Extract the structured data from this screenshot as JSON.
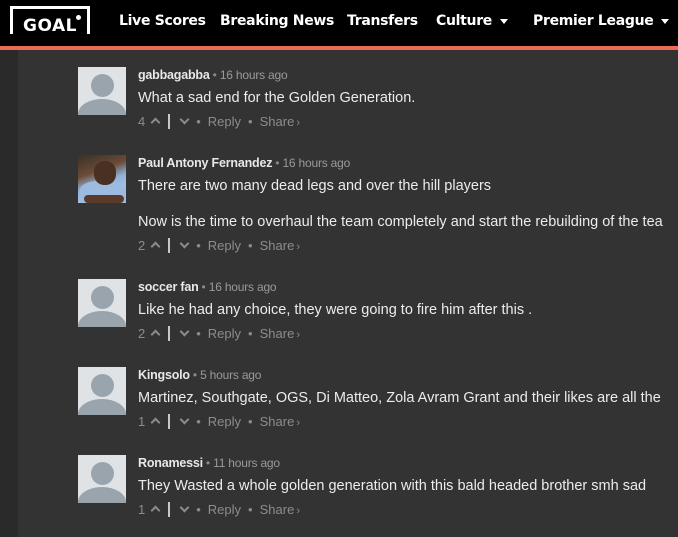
{
  "header": {
    "logo_text": "GOAL",
    "nav": [
      {
        "label": "Live Scores",
        "has_dropdown": false
      },
      {
        "label": "Breaking News",
        "has_dropdown": false
      },
      {
        "label": "Transfers",
        "has_dropdown": false
      },
      {
        "label": "Culture",
        "has_dropdown": true
      },
      {
        "label": "Premier League",
        "has_dropdown": true
      }
    ],
    "accent_color": "#ee6a56"
  },
  "comments": [
    {
      "author": "gabbagabba",
      "time": "16 hours ago",
      "paragraphs": [
        "What a sad end for the Golden Generation."
      ],
      "votes": "4",
      "reply_label": "Reply",
      "share_label": "Share",
      "avatar": "default-avatar"
    },
    {
      "author": "Paul Antony Fernandez",
      "time": "16 hours ago",
      "paragraphs": [
        "There are two many dead legs and over the hill players",
        "Now is the time to overhaul the team completely and start the rebuilding of the tea"
      ],
      "votes": "2",
      "reply_label": "Reply",
      "share_label": "Share",
      "avatar": "user-photo"
    },
    {
      "author": "soccer fan",
      "time": "16 hours ago",
      "paragraphs": [
        "Like he had any choice, they were going to fire him after this ."
      ],
      "votes": "2",
      "reply_label": "Reply",
      "share_label": "Share",
      "avatar": "default-avatar"
    },
    {
      "author": "Kingsolo",
      "time": "5 hours ago",
      "paragraphs": [
        "Martinez, Southgate, OGS, Di Matteo, Zola Avram Grant and their likes are all the"
      ],
      "votes": "1",
      "reply_label": "Reply",
      "share_label": "Share",
      "avatar": "default-avatar"
    },
    {
      "author": "Ronamessi",
      "time": "11 hours ago",
      "paragraphs": [
        "They Wasted a whole golden generation with this bald headed brother smh sad"
      ],
      "votes": "1",
      "reply_label": "Reply",
      "share_label": "Share",
      "avatar": "default-avatar"
    }
  ],
  "separators": {
    "dot": "•",
    "share_arrow": "›"
  }
}
